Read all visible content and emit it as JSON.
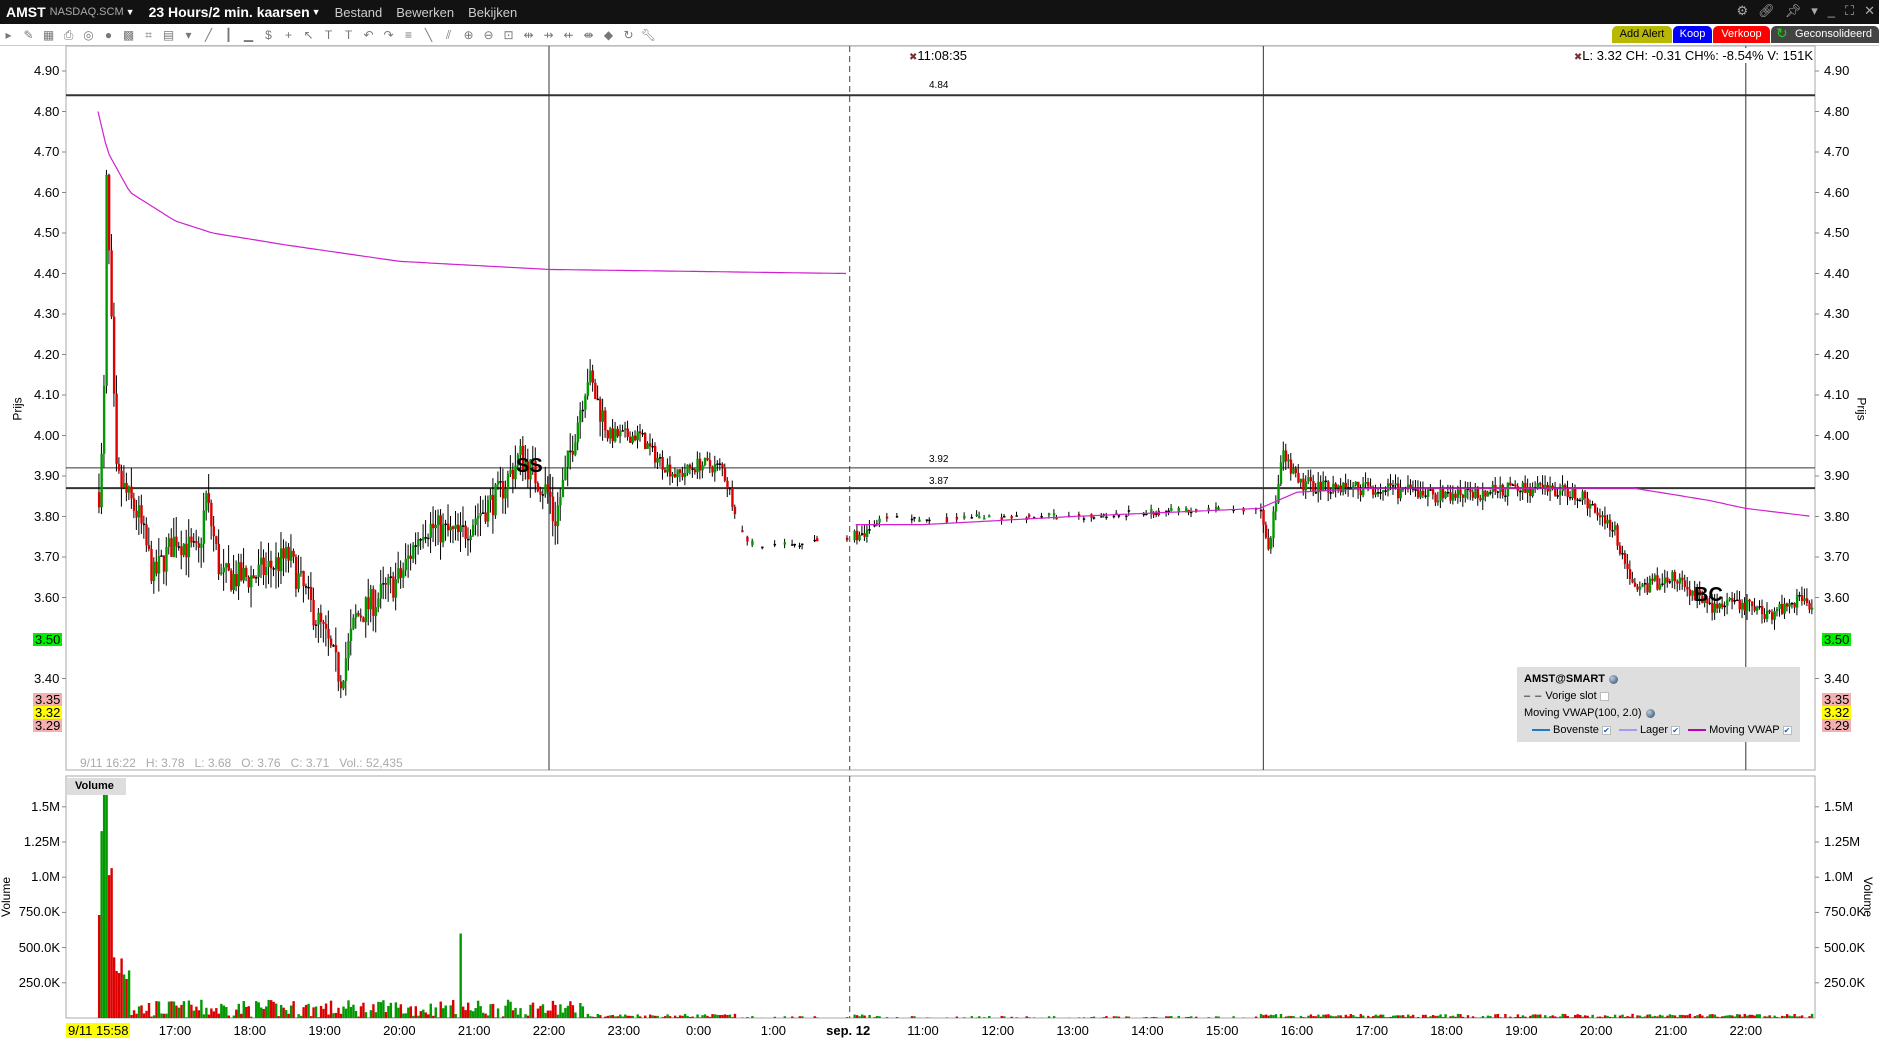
{
  "titlebar": {
    "symbol": "AMST",
    "exchange": "NASDAQ.SCM",
    "period": "23 Hours/2 min. kaarsen",
    "menus": [
      "Bestand",
      "Bewerken",
      "Bekijken"
    ]
  },
  "toolbar": {
    "add_alert": "Add Alert",
    "buy": "Koop",
    "sell": "Verkoop",
    "consolidated": "Geconsolideerd"
  },
  "colors": {
    "up": "#009900",
    "down": "#dd0000",
    "vwap": "#d020d0",
    "last_price": "#ffff00",
    "level_green": "#00ee00",
    "level_pink": "#f4b0b0",
    "button_alert": "#b8b800",
    "button_buy": "#0000ff",
    "button_sell": "#ff0000"
  },
  "crosshair": {
    "time": "11:08:35",
    "quote": "L: 3.32 CH: -0.31 CH%: -8.54% V: 151K"
  },
  "status_line": "9/11 16:22   H: 3.78   L: 3.68   O: 3.76   C: 3.71   Vol.: 52,435",
  "price_axis": {
    "label": "Prijs",
    "ticks": [
      "4.90",
      "4.80",
      "4.70",
      "4.60",
      "4.50",
      "4.40",
      "4.30",
      "4.20",
      "4.10",
      "4.00",
      "3.90",
      "3.80",
      "3.70",
      "3.60",
      "3.40"
    ],
    "tick_values": [
      4.9,
      4.8,
      4.7,
      4.6,
      4.5,
      4.4,
      4.3,
      4.2,
      4.1,
      4.0,
      3.9,
      3.8,
      3.7,
      3.6,
      3.4
    ]
  },
  "price_tags": {
    "green": "3.50",
    "pink_high": "3.35",
    "last": "3.32",
    "pink_low": "3.29"
  },
  "levels": [
    {
      "label": "4.84",
      "value": 4.84
    },
    {
      "label": "3.92",
      "value": 3.92
    },
    {
      "label": "3.87",
      "value": 3.87
    }
  ],
  "annotations": [
    {
      "text": "SS"
    },
    {
      "text": "BC"
    }
  ],
  "volume_axis": {
    "label": "Volume",
    "pane_title": "Volume",
    "ticks": [
      "1.5M",
      "1.25M",
      "1.0M",
      "750.0K",
      "500.0K",
      "250.0K"
    ],
    "tick_values": [
      1500000,
      1250000,
      1000000,
      750000,
      500000,
      250000
    ]
  },
  "time_axis": {
    "start_label": "9/11 15:58",
    "labels": [
      "17:00",
      "18:00",
      "19:00",
      "20:00",
      "21:00",
      "22:00",
      "23:00",
      "0:00",
      "1:00",
      "sep. 12",
      "11:00",
      "12:00",
      "13:00",
      "14:00",
      "15:00",
      "16:00",
      "17:00",
      "18:00",
      "19:00",
      "20:00",
      "21:00",
      "22:00"
    ]
  },
  "legend": {
    "title": "AMST@SMART",
    "prev_close": "Vorige slot",
    "study": "Moving VWAP(100, 2.0)",
    "upper": "Bovenste",
    "lower": "Lager",
    "vwap": "Moving VWAP",
    "upper_color": "#1f78c8",
    "lower_color": "#a898f0",
    "vwap_color": "#c000c0"
  },
  "price_path": [
    [
      -1.03,
      3.86
    ],
    [
      -0.97,
      4.0
    ],
    [
      -0.93,
      4.62
    ],
    [
      -0.87,
      4.3
    ],
    [
      -0.8,
      3.9
    ],
    [
      -0.5,
      3.8
    ],
    [
      -0.3,
      3.65
    ],
    [
      0,
      3.75
    ],
    [
      0.3,
      3.7
    ],
    [
      0.4,
      3.85
    ],
    [
      0.6,
      3.65
    ],
    [
      1.0,
      3.65
    ],
    [
      1.5,
      3.7
    ],
    [
      2.0,
      3.5
    ],
    [
      2.2,
      3.4
    ],
    [
      2.4,
      3.55
    ],
    [
      3.0,
      3.65
    ],
    [
      3.3,
      3.78
    ],
    [
      3.8,
      3.75
    ],
    [
      4.0,
      3.8
    ],
    [
      4.3,
      3.85
    ],
    [
      4.6,
      3.95
    ],
    [
      5.0,
      3.85
    ],
    [
      5.05,
      3.78
    ],
    [
      5.2,
      3.9
    ],
    [
      5.5,
      4.15
    ],
    [
      5.8,
      4.0
    ],
    [
      6.2,
      4.0
    ],
    [
      6.4,
      3.95
    ],
    [
      6.7,
      3.9
    ],
    [
      7.0,
      3.93
    ],
    [
      7.3,
      3.92
    ],
    [
      7.6,
      3.75
    ],
    [
      7.8,
      3.72
    ],
    [
      8.2,
      3.73
    ],
    [
      8.9,
      3.75
    ],
    [
      9.1,
      3.75
    ],
    [
      9.5,
      3.8
    ],
    [
      10,
      3.79
    ],
    [
      11,
      3.8
    ],
    [
      12,
      3.8
    ],
    [
      13,
      3.81
    ],
    [
      14.5,
      3.82
    ],
    [
      14.6,
      3.72
    ],
    [
      14.8,
      3.95
    ],
    [
      15,
      3.88
    ],
    [
      16,
      3.87
    ],
    [
      17,
      3.85
    ],
    [
      18,
      3.87
    ],
    [
      18.7,
      3.86
    ],
    [
      19.2,
      3.78
    ],
    [
      19.5,
      3.62
    ],
    [
      20,
      3.65
    ],
    [
      20.5,
      3.58
    ],
    [
      21,
      3.58
    ],
    [
      21.3,
      3.56
    ],
    [
      21.7,
      3.6
    ],
    [
      21.9,
      3.58
    ]
  ],
  "vwap_path_1": [
    [
      -1.03,
      4.8
    ],
    [
      -0.9,
      4.7
    ],
    [
      -0.6,
      4.6
    ],
    [
      0,
      4.53
    ],
    [
      0.5,
      4.5
    ],
    [
      1.5,
      4.47
    ],
    [
      3,
      4.43
    ],
    [
      5,
      4.41
    ],
    [
      9,
      4.4
    ]
  ],
  "vwap_path_2": [
    [
      9.1,
      3.78
    ],
    [
      10,
      3.78
    ],
    [
      12,
      3.8
    ],
    [
      14.5,
      3.82
    ],
    [
      15,
      3.86
    ],
    [
      16,
      3.87
    ],
    [
      19.5,
      3.87
    ],
    [
      20.5,
      3.84
    ],
    [
      21,
      3.82
    ],
    [
      21.9,
      3.8
    ]
  ]
}
